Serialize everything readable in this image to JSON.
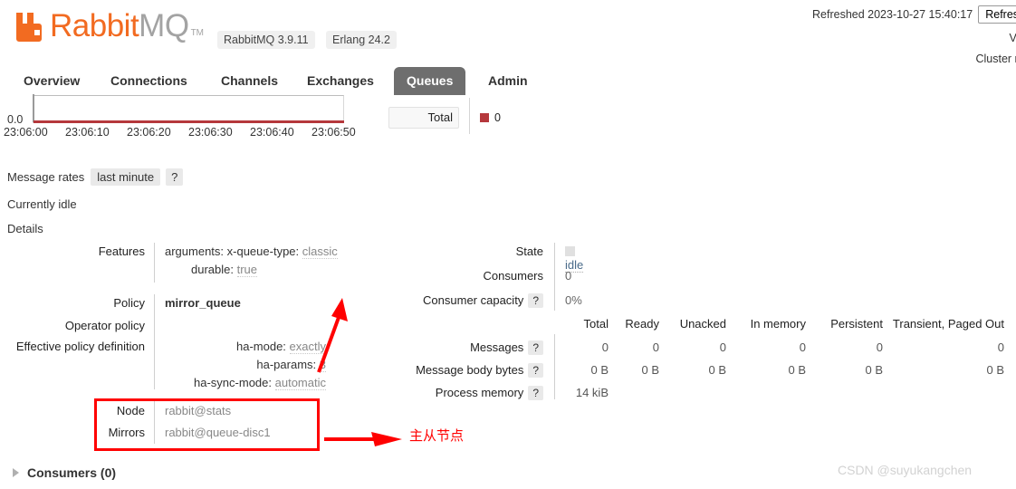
{
  "header": {
    "logo_rabbit": "Rabbit",
    "logo_mq": "MQ",
    "logo_tm": "TM",
    "version_server": "RabbitMQ 3.9.11",
    "version_erlang": "Erlang 24.2",
    "refreshed_text": "Refreshed 2023-10-27 15:40:17",
    "refresh_button": "Refresh",
    "vhost_line": "Virtu",
    "cluster_prefix": "Cluster ",
    "cluster_name": "rab"
  },
  "tabs": [
    {
      "label": "Overview",
      "active": false
    },
    {
      "label": "Connections",
      "active": false
    },
    {
      "label": "Channels",
      "active": false
    },
    {
      "label": "Exchanges",
      "active": false
    },
    {
      "label": "Queues",
      "active": true
    },
    {
      "label": "Admin",
      "active": false
    }
  ],
  "chart": {
    "y_min_label": "0.0",
    "x_labels": [
      "23:06:00",
      "23:06:10",
      "23:06:20",
      "23:06:30",
      "23:06:40",
      "23:06:50"
    ],
    "total_button": "Total",
    "legend_value": "0",
    "legend_color": "#b5383c"
  },
  "rates": {
    "label": "Message rates",
    "period": "last minute",
    "help": "?",
    "idle_text": "Currently idle",
    "details_text": "Details"
  },
  "features": {
    "label": "Features",
    "rows": [
      {
        "key": "arguments: x-queue-type:",
        "value": "classic"
      },
      {
        "key": "durable:",
        "value": "true"
      }
    ]
  },
  "policy": {
    "policy_label": "Policy",
    "policy_value": "mirror_queue",
    "operator_policy_label": "Operator policy",
    "operator_policy_value": "",
    "effective_label": "Effective policy definition",
    "effective_rows": [
      {
        "key": "ha-mode:",
        "value": "exactly"
      },
      {
        "key": "ha-params:",
        "value": "3"
      },
      {
        "key": "ha-sync-mode:",
        "value": "automatic"
      }
    ]
  },
  "nodes": {
    "node_label": "Node",
    "node_value": "rabbit@stats",
    "mirrors_label": "Mirrors",
    "mirrors_value": "rabbit@queue-disc1"
  },
  "status": {
    "state_label": "State",
    "state_value": "idle",
    "consumers_label": "Consumers",
    "consumers_value": "0",
    "capacity_label": "Consumer capacity",
    "capacity_help": "?",
    "capacity_value": "0%"
  },
  "stats_table": {
    "columns": [
      "Total",
      "Ready",
      "Unacked",
      "In memory",
      "Persistent",
      "Transient, Paged Out"
    ],
    "rows": [
      {
        "label": "Messages",
        "help": "?",
        "values": [
          "0",
          "0",
          "0",
          "0",
          "0",
          "0"
        ]
      },
      {
        "label": "Message body bytes",
        "help": "?",
        "values": [
          "0 B",
          "0 B",
          "0 B",
          "0 B",
          "0 B",
          "0 B"
        ]
      },
      {
        "label": "Process memory",
        "help": "?",
        "values": [
          "14 kiB",
          "",
          "",
          "",
          "",
          ""
        ]
      }
    ]
  },
  "consumers_section": {
    "label": "Consumers (0)"
  },
  "annotations": {
    "chinese_note": "主从节点",
    "color": "#ff0000"
  },
  "watermark": "CSDN @suyukangchen"
}
